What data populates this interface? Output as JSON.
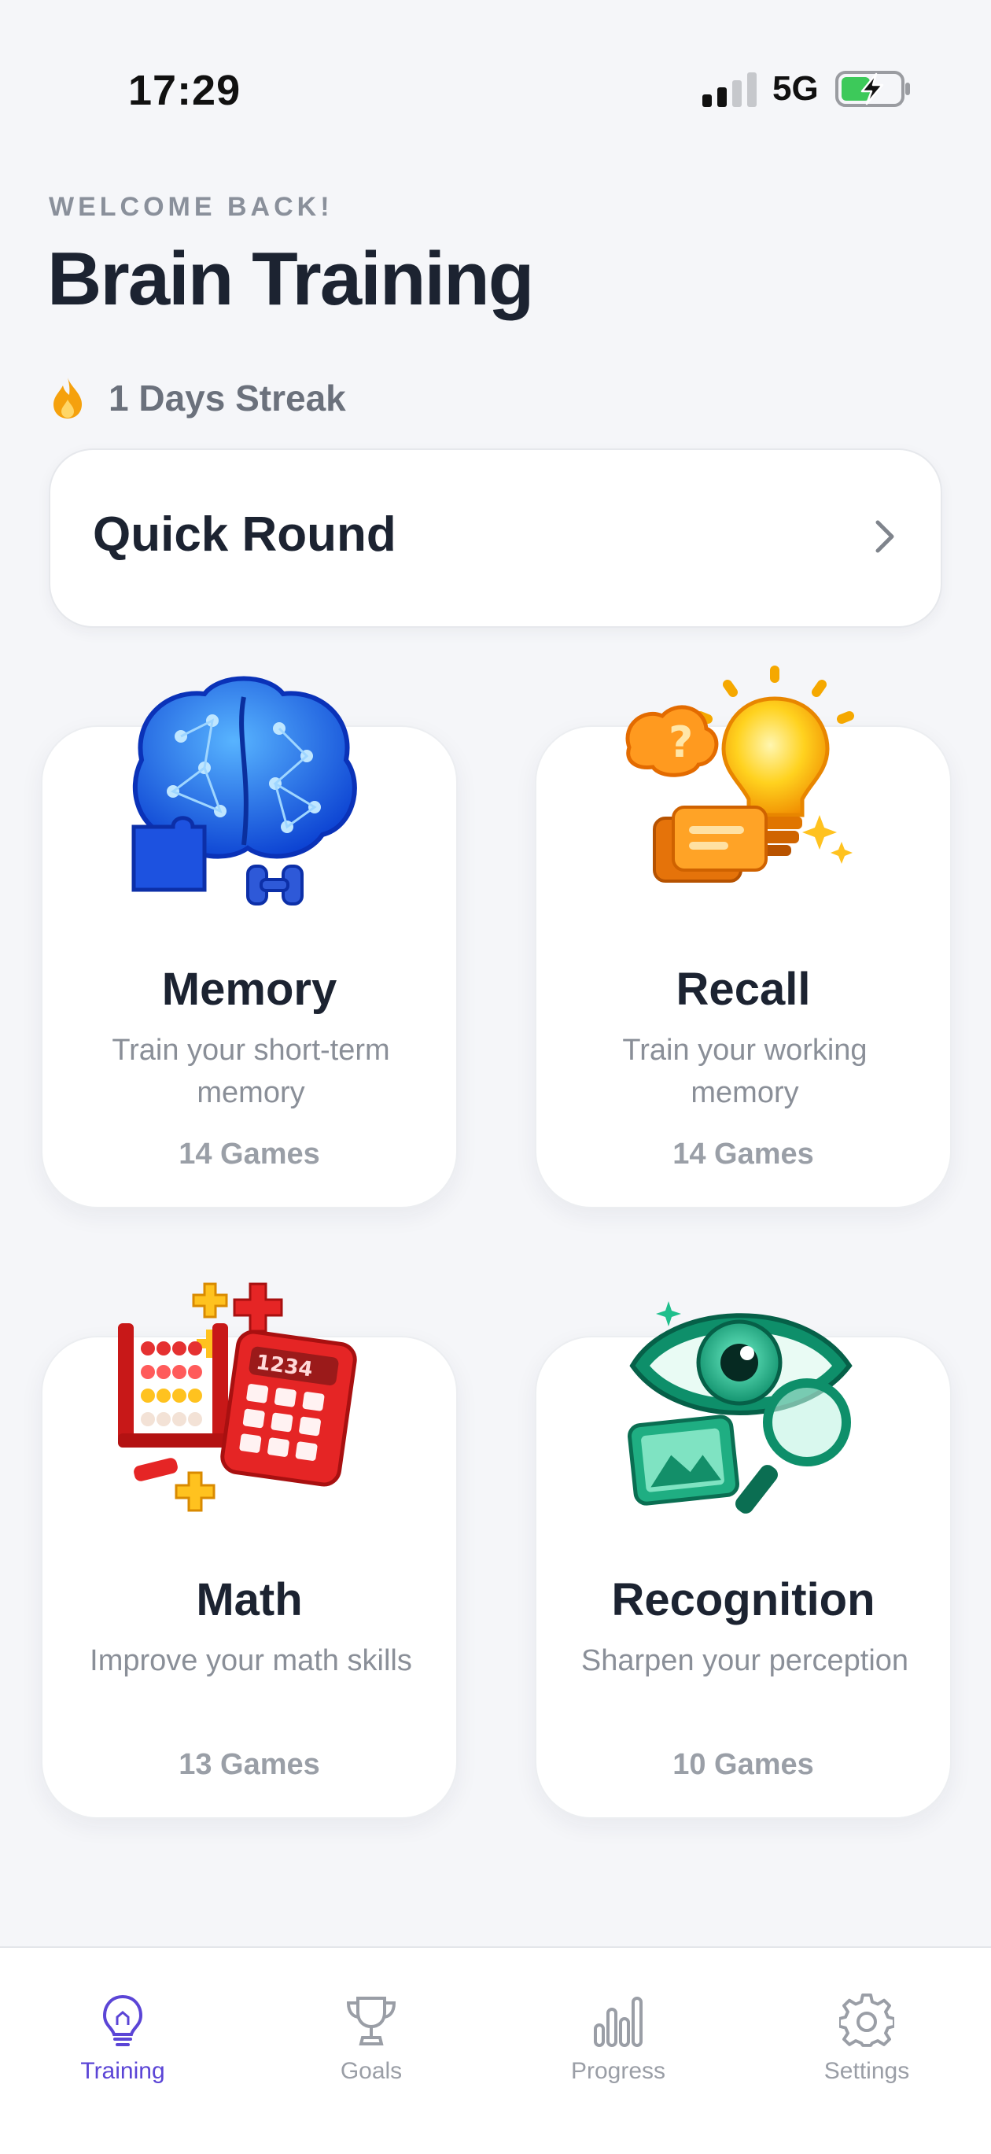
{
  "status_bar": {
    "time": "17:29",
    "network": "5G"
  },
  "header": {
    "welcome": "WELCOME BACK!",
    "title": "Brain Training",
    "streak": "1 Days Streak"
  },
  "quick_round": {
    "label": "Quick Round"
  },
  "categories": [
    {
      "title": "Memory",
      "description": "Train your short-term memory",
      "count": "14 Games",
      "icon": "brain-icon"
    },
    {
      "title": "Recall",
      "description": "Train your working memory",
      "count": "14 Games",
      "icon": "lightbulb-icon"
    },
    {
      "title": "Math",
      "description": "Improve your math skills",
      "count": "13 Games",
      "icon": "calculator-icon"
    },
    {
      "title": "Recognition",
      "description": "Sharpen your perception",
      "count": "10 Games",
      "icon": "eye-icon"
    }
  ],
  "tabs": [
    {
      "label": "Training",
      "icon": "lightbulb-icon",
      "active": true
    },
    {
      "label": "Goals",
      "icon": "trophy-icon",
      "active": false
    },
    {
      "label": "Progress",
      "icon": "bar-chart-icon",
      "active": false
    },
    {
      "label": "Settings",
      "icon": "gear-icon",
      "active": false
    }
  ],
  "colors": {
    "accent": "#5b45d6",
    "streak_flame": "#f5a10d",
    "background": "#f5f6f9"
  }
}
